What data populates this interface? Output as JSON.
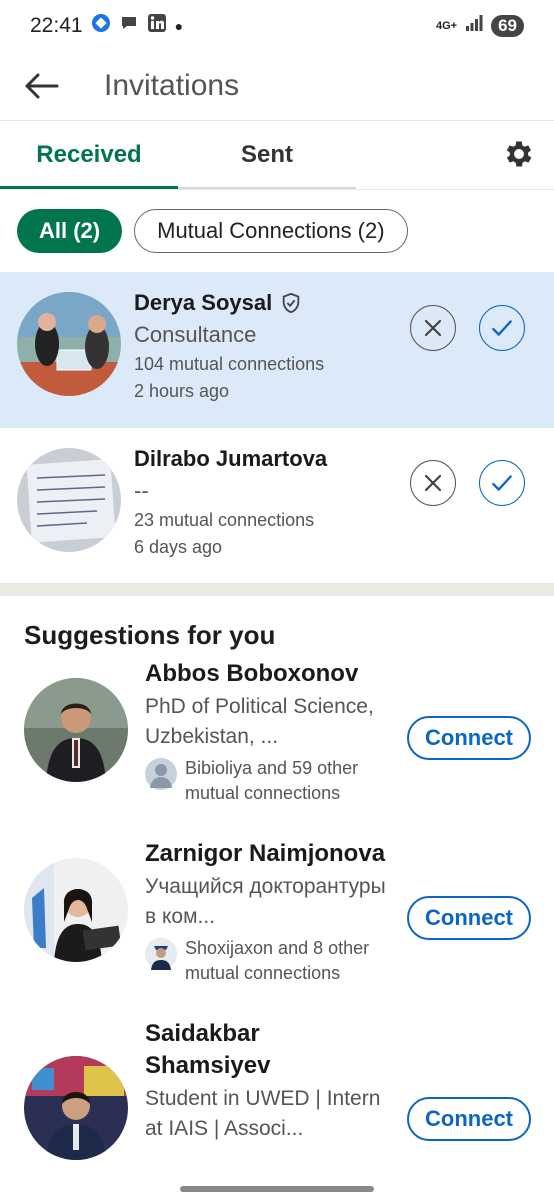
{
  "status_bar": {
    "time": "22:41",
    "network": "4G+",
    "battery": "69"
  },
  "header": {
    "title": "Invitations"
  },
  "tabs": [
    {
      "label": "Received"
    },
    {
      "label": "Sent"
    }
  ],
  "filters": [
    {
      "label": "All (2)"
    },
    {
      "label": "Mutual Connections (2)"
    }
  ],
  "invitations": [
    {
      "name": "Derya Soysal",
      "headline": "Consultance",
      "mutual": "104 mutual connections",
      "time": "2 hours ago"
    },
    {
      "name": "Dilrabo Jumartova",
      "headline": "--",
      "mutual": "23 mutual connections",
      "time": "6 days ago"
    }
  ],
  "suggestions_title": "Suggestions for you",
  "suggestions": [
    {
      "name": "Abbos Boboxonov",
      "headline": "PhD of Political Science, Uzbekistan, ...",
      "mutual": "Bibioliya and 59 other mutual connections",
      "button": "Connect"
    },
    {
      "name": "Zarnigor Naimjonova",
      "headline": "Учащийся докторантуры в ком...",
      "mutual": "Shoxijaxon and 8 other mutual connections",
      "button": "Connect"
    },
    {
      "name": "Saidakbar Shamsiyev",
      "headline": "Student in UWED | Intern at IAIS | Associ...",
      "mutual": "",
      "button": "Connect"
    }
  ],
  "colors": {
    "accent_green": "#01754f",
    "link_blue": "#0a66c2",
    "highlight": "#dce9f8"
  }
}
